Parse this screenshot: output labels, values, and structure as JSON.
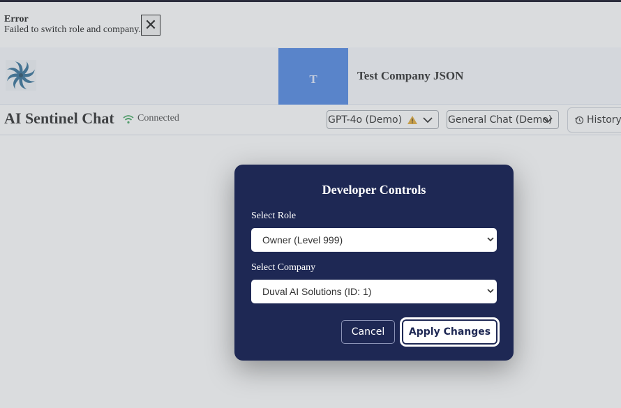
{
  "error": {
    "title": "Error",
    "message": "Failed to switch role and company.",
    "close_icon": "close-icon"
  },
  "company_bar": {
    "avatar_initial": "T",
    "company_name": "Test Company JSON",
    "logo_icon": "spiral-logo-icon"
  },
  "chat_header": {
    "title": "AI Sentinel Chat",
    "status": "Connected",
    "status_icon": "wifi-icon",
    "status_color": "#2e9e4f",
    "model_select": {
      "value": "GPT-4o (Demo)",
      "warning_icon": "warning-icon"
    },
    "mode_select": {
      "value": "General Chat (Demo)"
    },
    "history_button": {
      "label": "History",
      "icon": "history-icon"
    }
  },
  "modal": {
    "title": "Developer Controls",
    "role_label": "Select Role",
    "role_value": "Owner (Level 999)",
    "company_label": "Select Company",
    "company_value": "Duval AI Solutions (ID: 1)",
    "cancel_label": "Cancel",
    "apply_label": "Apply Changes",
    "background_color": "#1e2854"
  },
  "colors": {
    "accent": "#3a78e0",
    "modal_bg": "#1e2854",
    "warning": "#e0a020"
  }
}
